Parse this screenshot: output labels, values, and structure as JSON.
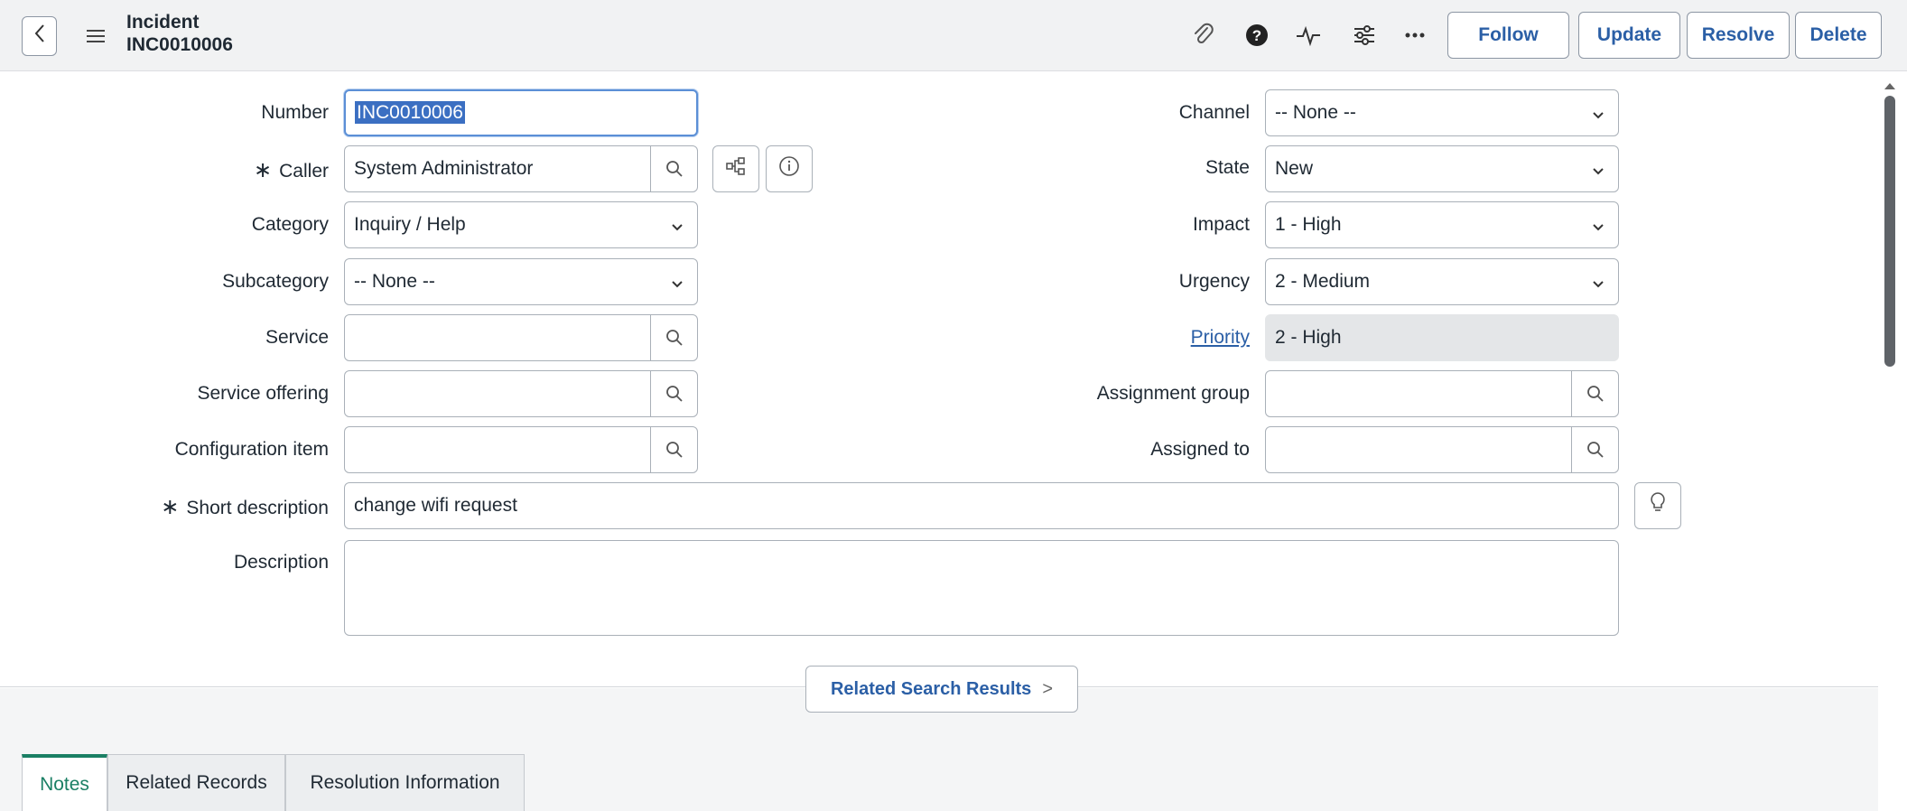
{
  "header": {
    "record_type": "Incident",
    "record_number": "INC0010006",
    "buttons": {
      "follow": "Follow",
      "update": "Update",
      "resolve": "Resolve",
      "delete": "Delete"
    },
    "icons": [
      "back-icon",
      "hamburger-menu-icon",
      "paperclip-icon",
      "help-icon",
      "activity-icon",
      "settings-sliders-icon",
      "more-icon"
    ]
  },
  "form": {
    "number": {
      "label": "Number",
      "value": "INC0010006"
    },
    "caller": {
      "label": "Caller",
      "value": "System Administrator",
      "required": true
    },
    "category": {
      "label": "Category",
      "value": "Inquiry / Help"
    },
    "subcategory": {
      "label": "Subcategory",
      "value": "-- None --"
    },
    "service": {
      "label": "Service",
      "value": ""
    },
    "service_offering": {
      "label": "Service offering",
      "value": ""
    },
    "configuration_item": {
      "label": "Configuration item",
      "value": ""
    },
    "short_description": {
      "label": "Short description",
      "value": "change wifi request",
      "required": true
    },
    "description": {
      "label": "Description",
      "value": ""
    },
    "channel": {
      "label": "Channel",
      "value": "-- None --"
    },
    "state": {
      "label": "State",
      "value": "New"
    },
    "impact": {
      "label": "Impact",
      "value": "1 - High"
    },
    "urgency": {
      "label": "Urgency",
      "value": "2 - Medium"
    },
    "priority": {
      "label": "Priority",
      "value": "2 - High"
    },
    "assignment_group": {
      "label": "Assignment group",
      "value": ""
    },
    "assigned_to": {
      "label": "Assigned to",
      "value": ""
    },
    "required_marker": "∗"
  },
  "related_search": {
    "label": "Related Search Results",
    "chevron": ">"
  },
  "tabs": [
    {
      "label": "Notes",
      "active": true
    },
    {
      "label": "Related Records",
      "active": false
    },
    {
      "label": "Resolution Information",
      "active": false
    }
  ],
  "colors": {
    "accent": "#2b5fa6",
    "active_tab": "#1a7f64",
    "header_bg": "#f1f2f3"
  }
}
